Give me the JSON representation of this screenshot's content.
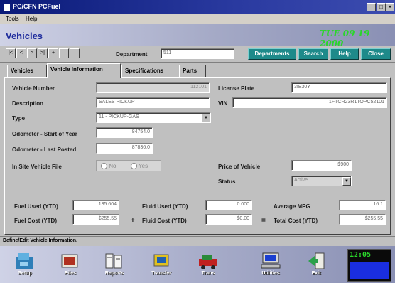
{
  "window": {
    "title": "PC/CFN PCFuel"
  },
  "menu": {
    "items": [
      "Tools",
      "Help"
    ]
  },
  "header": {
    "title": "Vehicles",
    "date": "TUE 09 19 2000"
  },
  "toolbar": {
    "nav_buttons": [
      "|<",
      "<",
      ">",
      ">|",
      "+",
      "–",
      "–"
    ],
    "department_label": "Department",
    "department_value": "511",
    "buttons": {
      "departments": "Departments",
      "search": "Search",
      "help": "Help",
      "close": "Close"
    }
  },
  "tabs": [
    "Vehicles",
    "Vehicle Information",
    "Specifications",
    "Parts"
  ],
  "form": {
    "vehicle_number": {
      "label": "Vehicle Number",
      "value": "112101"
    },
    "license_plate": {
      "label": "License Plate",
      "value": "3IE30Y"
    },
    "description": {
      "label": "Description",
      "value": "SALES PICKUP"
    },
    "vin": {
      "label": "VIN",
      "value": "1FTCR23R1TOPC52101"
    },
    "type": {
      "label": "Type",
      "value": "11 - PICKUP-GAS"
    },
    "odometer_start": {
      "label": "Odometer - Start of Year",
      "value": "84754.0"
    },
    "odometer_last": {
      "label": "Odometer - Last Posted",
      "value": "87836.0"
    },
    "insite": {
      "label": "In Site Vehicle File",
      "opt_no": "No",
      "opt_yes": "Yes"
    },
    "price": {
      "label": "Price of Vehicle",
      "value": "$900"
    },
    "status": {
      "label": "Status",
      "value": "Active"
    },
    "fuel_used": {
      "label": "Fuel Used (YTD)",
      "value": "135.604"
    },
    "fluid_used": {
      "label": "Fluid Used (YTD)",
      "value": "0.000"
    },
    "avg_mpg": {
      "label": "Average MPG",
      "value": "16.1"
    },
    "fuel_cost": {
      "label": "Fuel Cost (YTD)",
      "value": "$255.55"
    },
    "plus": "+",
    "fluid_cost": {
      "label": "Fluid Cost (YTD)",
      "value": "$0.00"
    },
    "equals": "=",
    "total_cost": {
      "label": "Total Cost (YTD)",
      "value": "$255.55"
    }
  },
  "status_bar": {
    "text": "Define/Edit Vehicle Information."
  },
  "launcher": {
    "items": [
      {
        "label": "Setup",
        "icon": "setup-icon"
      },
      {
        "label": "Files",
        "icon": "files-icon"
      },
      {
        "label": "Reports",
        "icon": "reports-icon"
      },
      {
        "label": "Transfer",
        "icon": "transfer-icon"
      },
      {
        "label": "Trans",
        "icon": "trans-icon"
      },
      {
        "label": "Utilities",
        "icon": "utilities-icon"
      },
      {
        "label": "Exit",
        "icon": "exit-icon"
      }
    ],
    "clock": "12:05"
  }
}
